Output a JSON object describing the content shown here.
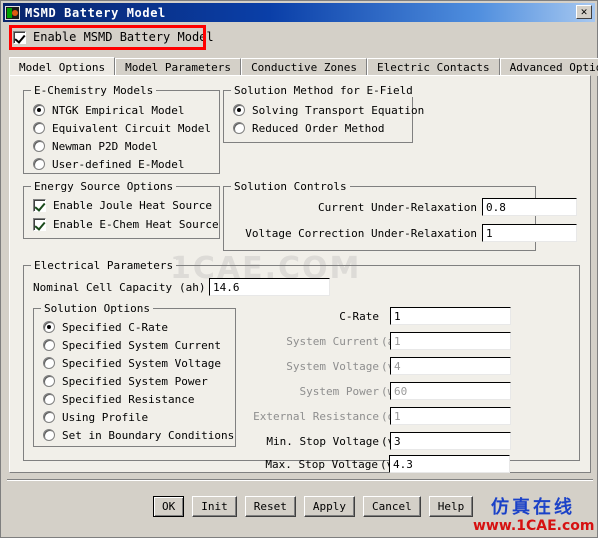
{
  "window": {
    "title": "MSMD Battery Model",
    "icon": "app-icon",
    "close_label": "✕"
  },
  "enable": {
    "label": "Enable MSMD Battery Model",
    "checked": true,
    "highlight_color": "#ff0000"
  },
  "tabs": [
    {
      "label": "Model Options",
      "active": true
    },
    {
      "label": "Model Parameters",
      "active": false
    },
    {
      "label": "Conductive Zones",
      "active": false
    },
    {
      "label": "Electric Contacts",
      "active": false
    },
    {
      "label": "Advanced Option",
      "active": false
    }
  ],
  "echemistry": {
    "title": "E-Chemistry Models",
    "options": [
      {
        "label": "NTGK Empirical Model",
        "selected": true
      },
      {
        "label": "Equivalent Circuit Model",
        "selected": false
      },
      {
        "label": "Newman P2D Model",
        "selected": false
      },
      {
        "label": "User-defined E-Model",
        "selected": false
      }
    ]
  },
  "solution_method": {
    "title": "Solution Method for E-Field",
    "options": [
      {
        "label": "Solving Transport Equation",
        "selected": true
      },
      {
        "label": "Reduced Order Method",
        "selected": false
      }
    ]
  },
  "energy_source": {
    "title": "Energy Source Options",
    "options": [
      {
        "label": "Enable Joule Heat Source",
        "checked": true
      },
      {
        "label": "Enable E-Chem Heat Source",
        "checked": true
      }
    ]
  },
  "solution_controls": {
    "title": "Solution Controls",
    "fields": [
      {
        "label": "Current Under-Relaxation",
        "value": "0.8",
        "enabled": true
      },
      {
        "label": "Voltage Correction Under-Relaxation",
        "value": "1",
        "enabled": true
      }
    ]
  },
  "electrical_parameters": {
    "title": "Electrical Parameters",
    "capacity_label": "Nominal Cell Capacity",
    "capacity_unit": "(ah)",
    "capacity_value": "14.6",
    "solution_options": {
      "title": "Solution Options",
      "options": [
        {
          "label": "Specified C-Rate",
          "selected": true
        },
        {
          "label": "Specified System Current",
          "selected": false
        },
        {
          "label": "Specified System Voltage",
          "selected": false
        },
        {
          "label": "Specified System Power",
          "selected": false
        },
        {
          "label": "Specified Resistance",
          "selected": false
        },
        {
          "label": "Using Profile",
          "selected": false
        },
        {
          "label": "Set in Boundary Conditions",
          "selected": false
        }
      ]
    },
    "value_fields": [
      {
        "label": "C-Rate",
        "unit": "",
        "value": "1",
        "enabled": true
      },
      {
        "label": "System Current",
        "unit": "(a)",
        "value": "1",
        "enabled": false
      },
      {
        "label": "System Voltage",
        "unit": "(v)",
        "value": "4",
        "enabled": false
      },
      {
        "label": "System Power",
        "unit": "(w)",
        "value": "60",
        "enabled": false
      },
      {
        "label": "External Resistance",
        "unit": "(ohm)",
        "value": "1",
        "enabled": false
      },
      {
        "label": "Min. Stop Voltage",
        "unit": "(v)",
        "value": "3",
        "enabled": true
      },
      {
        "label": "Max. Stop Voltage",
        "unit": "(v)",
        "value": "4.3",
        "enabled": true
      }
    ]
  },
  "buttons": [
    {
      "label": "OK",
      "default": true
    },
    {
      "label": "Init",
      "default": false
    },
    {
      "label": "Reset",
      "default": false
    },
    {
      "label": "Apply",
      "default": false
    },
    {
      "label": "Cancel",
      "default": false
    },
    {
      "label": "Help",
      "default": false
    }
  ],
  "watermark": {
    "big": "1CAE.COM",
    "chinese": "仿真在线",
    "url": "www.1CAE.com"
  }
}
